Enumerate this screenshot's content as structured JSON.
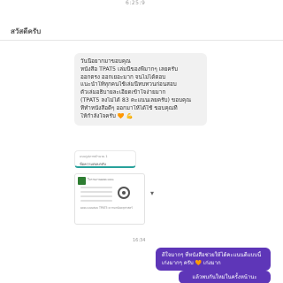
{
  "status": {
    "time": "6:25:9"
  },
  "chat": {
    "title": "สวัสดีครับ",
    "incoming": {
      "lines": [
        "วันนี้อยากมาขอบคุณ",
        "หนังสือ TPAT5 เล่มนี้ของพี่มากๆ เลยครับ",
        "ออกตรง ออกเยอะมาก จนไม่ได้ตอบ",
        "แนะนำให้ทุกคนใช้เล่มนี้ทบทวนก่อนสอบ",
        "ตัวเล่มอธิบายละเอียดเข้าใจง่ายมาก",
        "(TPAT5 ลงไม่ได้ 83 คะแนนเลยครับ) ขอบคุณ",
        "ที่ทำหนังสือดีๆ ออกมาให้ได้ใช้ ขอบคุณที่",
        "ให้กำลังใจครับ 🧡 💪"
      ]
    },
    "preview": {
      "line1": "แนบรูปภาพจำนวน 1",
      "line2": "ข้อความตอบกลับ"
    },
    "document": {
      "header": "ใบรายงานผลคะแนน",
      "text": "ผลคะแนนสอบ TPAT5 ความถนัดครุศาสตร์"
    },
    "outgoing_time": "16:34",
    "outgoing": {
      "lines": [
        "ดีใจมากๆ ที่หนังสือช่วยให้ได้คะแนนดีแบบนี้",
        "เก่งมากๆ ครับ 🧡 เก่งมาก"
      ]
    },
    "outgoing2": {
      "text": "แล้วพบกันใหม่ในครั้งหน้านะ"
    }
  }
}
